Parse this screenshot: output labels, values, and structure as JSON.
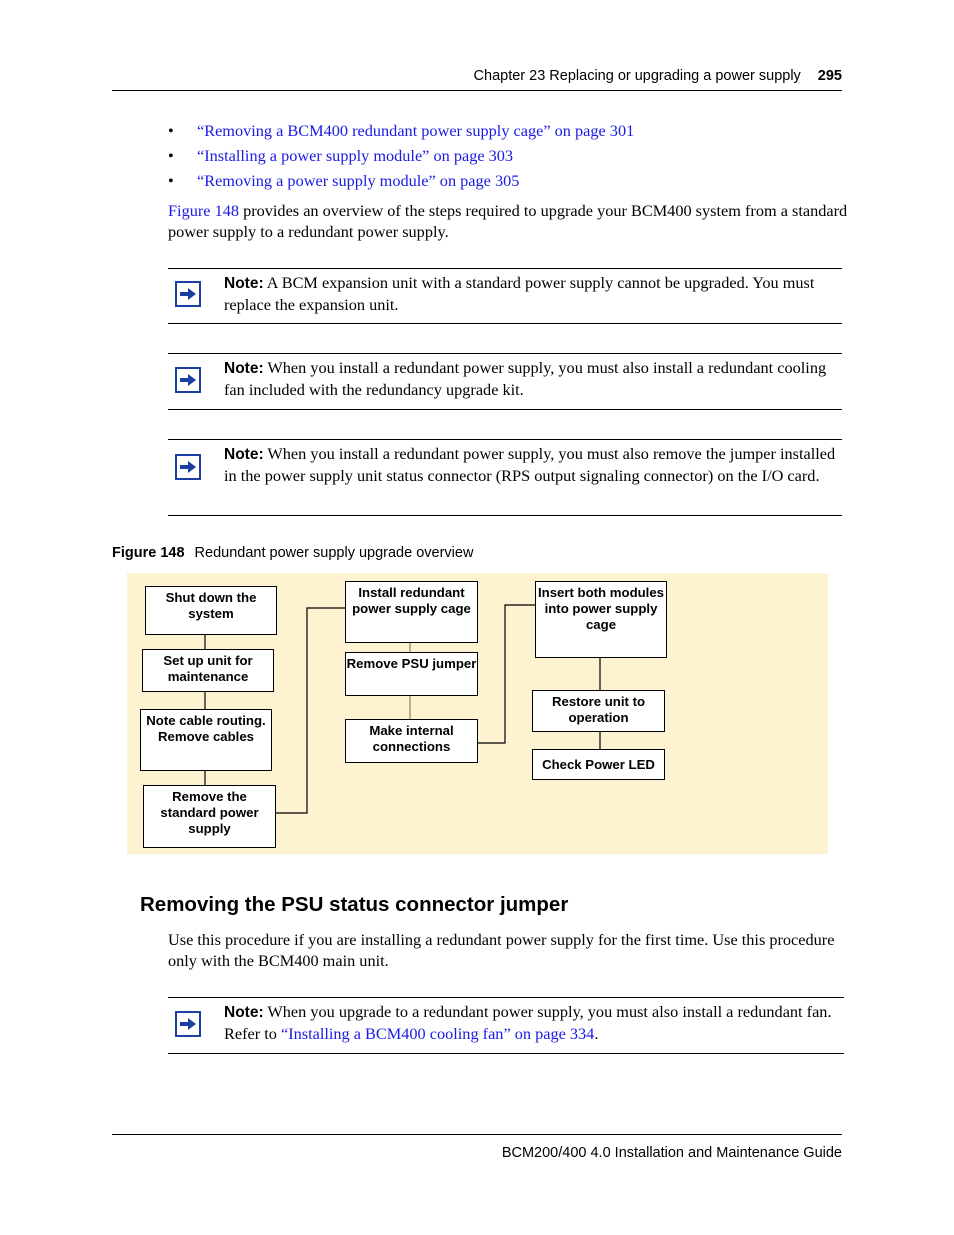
{
  "header": {
    "chapter": "Chapter 23  Replacing or upgrading a power supply",
    "page_number": "295"
  },
  "bullets": [
    "“Removing a BCM400 redundant power supply cage” on page 301",
    "“Installing a power supply module” on page 303",
    "“Removing a power supply module” on page 305"
  ],
  "bullet_glyph": "•",
  "intro": {
    "link": "Figure 148",
    "text": " provides an overview of the steps required to upgrade your BCM400 system from a standard power supply to a redundant power supply."
  },
  "notes": [
    {
      "label": "Note:",
      "text": " A BCM expansion unit with a standard power supply cannot be upgraded. You must replace the expansion unit."
    },
    {
      "label": "Note:",
      "text": " When you install a redundant power supply, you must also install a redundant cooling fan included with the redundancy upgrade kit."
    },
    {
      "label": "Note:",
      "text": " When you install a redundant power supply, you must also remove the jumper installed in the power supply unit status connector (RPS output signaling connector) on the I/O card."
    }
  ],
  "figure": {
    "label": "Figure 148",
    "title": "Redundant power supply upgrade overview",
    "background_color": "#fdf3d0",
    "steps": [
      "Shut down the system",
      "Set up unit for maintenance",
      "Note cable routing. Remove cables",
      "Remove the standard power supply",
      "Install redundant power supply cage",
      "Remove PSU jumper",
      "Make internal connections",
      "Insert both modules into power supply cage",
      "Restore unit to operation",
      "Check Power LED"
    ]
  },
  "section": {
    "heading": "Removing the PSU status connector jumper",
    "paragraph": "Use this procedure if you are installing a redundant power supply for the first time. Use this procedure only with the BCM400 main unit.",
    "note": {
      "label": "Note:",
      "text_before": " When you upgrade to a redundant power supply, you must also install a redundant fan. Refer to ",
      "link": "“Installing a BCM400 cooling fan” on page 334",
      "text_after": "."
    }
  },
  "footer": {
    "guide_title": "BCM200/400 4.0 Installation and Maintenance Guide"
  },
  "colors": {
    "link": "#1a1ae6",
    "note_icon": "#1b3fa0"
  }
}
